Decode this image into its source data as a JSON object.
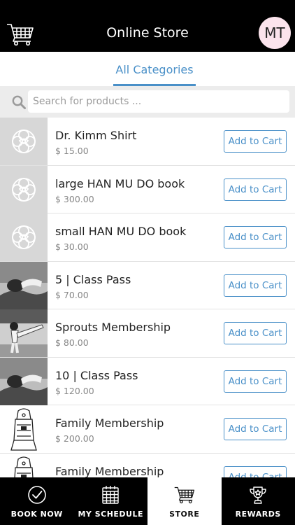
{
  "header": {
    "title": "Online Store",
    "avatar_initials": "MT",
    "cart_icon": "cart-icon"
  },
  "tabs": [
    {
      "label": "All Categories",
      "active": true
    }
  ],
  "search": {
    "placeholder": "Search for products ..."
  },
  "products": [
    {
      "name": "Dr. Kimm Shirt",
      "price": "$ 15.00",
      "image": "placeholder",
      "button": "Add to Cart"
    },
    {
      "name": "large HAN MU DO book",
      "price": "$ 300.00",
      "image": "placeholder",
      "button": "Add to Cart"
    },
    {
      "name": "small HAN MU DO book",
      "price": "$ 30.00",
      "image": "placeholder",
      "button": "Add to Cart"
    },
    {
      "name": "5 | Class Pass",
      "price": "$ 70.00",
      "image": "photo-stretch",
      "button": "Add to Cart"
    },
    {
      "name": "Sprouts Membership",
      "price": "$ 80.00",
      "image": "photo-kick",
      "button": "Add to Cart"
    },
    {
      "name": "10 | Class Pass",
      "price": "$ 120.00",
      "image": "photo-stretch",
      "button": "Add to Cart"
    },
    {
      "name": "Family Membership",
      "price": "$ 200.00",
      "image": "drawing-figure",
      "button": "Add to Cart"
    },
    {
      "name": "Family Membership",
      "price": "",
      "image": "drawing-figure",
      "button": "Add to Cart"
    }
  ],
  "bottom_nav": [
    {
      "label": "BOOK NOW",
      "icon": "check-circle-icon",
      "active": false
    },
    {
      "label": "MY SCHEDULE",
      "icon": "calendar-icon",
      "active": false
    },
    {
      "label": "STORE",
      "icon": "cart-icon",
      "active": true
    },
    {
      "label": "REWARDS",
      "icon": "trophy-icon",
      "active": false
    }
  ],
  "colors": {
    "accent": "#4a90c8",
    "header_bg": "#000000",
    "avatar_bg": "#fbe3ec"
  }
}
